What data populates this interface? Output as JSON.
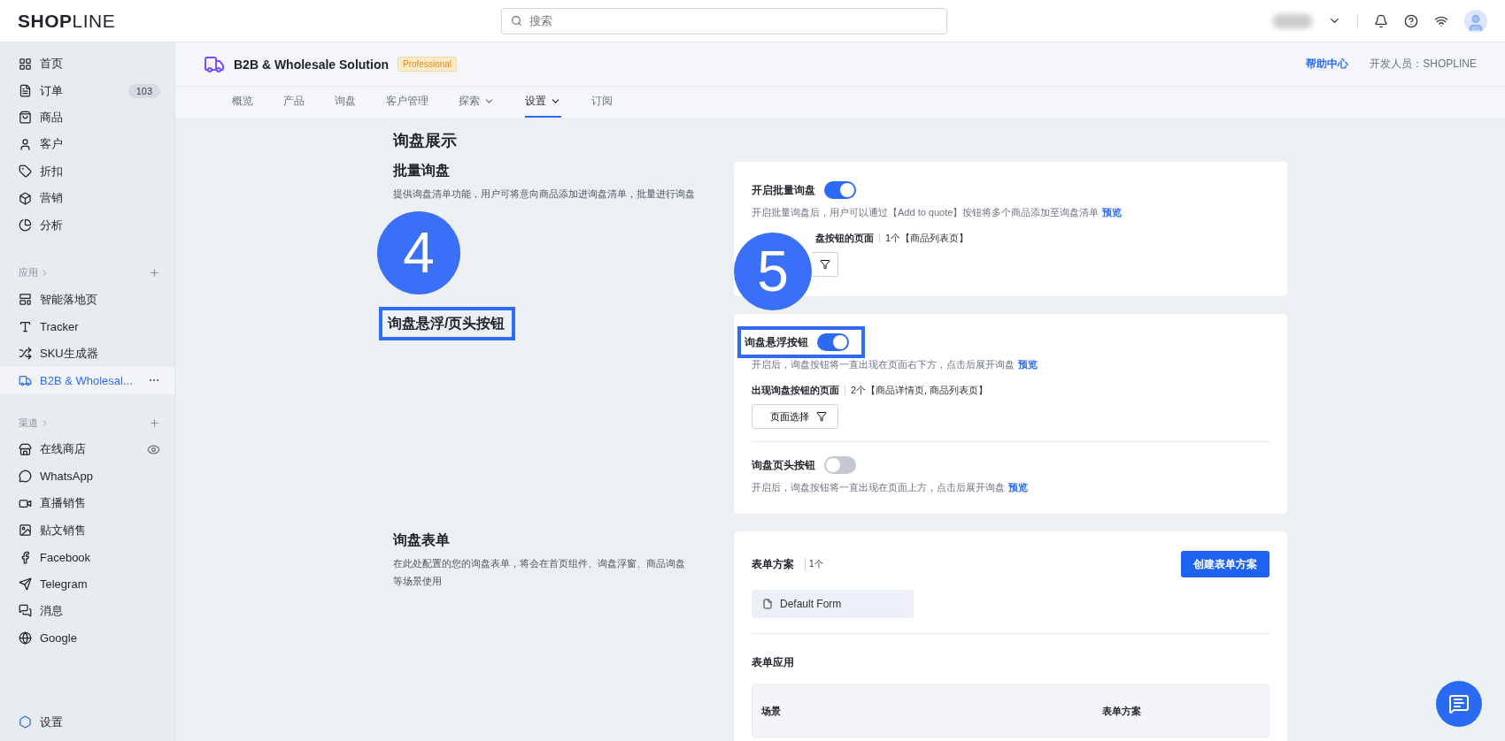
{
  "top_bar": {
    "logo": "**SHOP**LINE",
    "search": {
      "placeholder": "搜索"
    }
  },
  "sidebar": {
    "main_items": [
      {
        "label": "首页",
        "selected": false
      },
      {
        "label": "订单",
        "badge": "103",
        "selected": false
      },
      {
        "label": "商品",
        "selected": false
      },
      {
        "label": "客户",
        "selected": false
      },
      {
        "label": "折扣",
        "selected": false
      },
      {
        "label": "营销",
        "selected": false
      },
      {
        "label": "分析",
        "selected": false
      }
    ],
    "apps_section": {
      "label": "应用",
      "items": [
        {
          "label": "智能落地页",
          "selected": false
        },
        {
          "label": "Tracker",
          "selected": false
        },
        {
          "label": "SKU生成器",
          "selected": false
        },
        {
          "label": "B2B & Wholesal...",
          "selected": true
        }
      ]
    },
    "channels_section": {
      "label": "渠道",
      "items": [
        {
          "label": "在线商店",
          "selected": false,
          "visible_toggle": true
        },
        {
          "label": "WhatsApp",
          "selected": false
        },
        {
          "label": "直播销售",
          "selected": false
        },
        {
          "label": "贴文销售",
          "selected": false
        },
        {
          "label": "Facebook",
          "selected": false
        },
        {
          "label": "Telegram",
          "selected": false
        },
        {
          "label": "消息",
          "selected": false
        },
        {
          "label": "Google",
          "selected": false
        }
      ]
    },
    "footer_item": {
      "label": "设置"
    }
  },
  "app_header": {
    "title": "B2B & Wholesale Solution",
    "plan_badge": "Professional",
    "help_link": "帮助中心",
    "developer": "开发人员：SHOPLINE"
  },
  "tabs": [
    {
      "label": "概览",
      "selected": false
    },
    {
      "label": "产品",
      "selected": false
    },
    {
      "label": "询盘",
      "selected": false
    },
    {
      "label": "客户管理",
      "selected": false
    },
    {
      "label": "探索",
      "selected": false,
      "dropdown": true
    },
    {
      "label": "设置",
      "selected": true,
      "dropdown": true
    },
    {
      "label": "订阅",
      "selected": false
    }
  ],
  "page_title": "询盘展示",
  "sections": [
    {
      "kind": "settings",
      "title": "批量询盘",
      "description": "提供询盘清单功能，用户可将意向商品添加进询盘清单，批量进行询盘",
      "step_marker": "4",
      "highlighted": false,
      "card": {
        "step_marker": "5",
        "settings": [
          {
            "label": "开启批量询盘",
            "on": true,
            "highlighted": false,
            "hint": "开启批量询盘后，用户可以通过【Add to quote】按钮将多个商品添加至询盘清单",
            "hint_link": "预览",
            "pages_label": "盘按钮的页面",
            "pages_value": "1个【商品列表页】"
          }
        ]
      }
    },
    {
      "kind": "settings",
      "title": "询盘悬浮/页头按钮",
      "highlighted": true,
      "card": {
        "settings": [
          {
            "label": "询盘悬浮按钮",
            "on": true,
            "highlighted": true,
            "hint": "开启后，询盘按钮将一直出现在页面右下方，点击后展开询盘",
            "hint_link": "预览",
            "pages_label": "出现询盘按钮的页面",
            "pages_value": "2个【商品详情页, 商品列表页】",
            "page_button": "页面选择"
          },
          {
            "label": "询盘页头按钮",
            "on": false,
            "highlighted": false,
            "hint": "开启后，询盘按钮将一直出现在页面上方，点击后展开询盘",
            "hint_link": "预览"
          }
        ]
      }
    },
    {
      "kind": "forms",
      "title": "询盘表单",
      "description": "在此处配置的您的询盘表单，将会在首页组件、询盘浮窗、商品询盘等场景使用",
      "highlighted": false,
      "card": {
        "schemes_label": "表单方案",
        "schemes_count": "1个",
        "create_button": "创建表单方案",
        "forms": [
          "Default Form"
        ],
        "usage_title": "表单应用",
        "table_columns": [
          "场景",
          "表单方案"
        ]
      }
    }
  ]
}
